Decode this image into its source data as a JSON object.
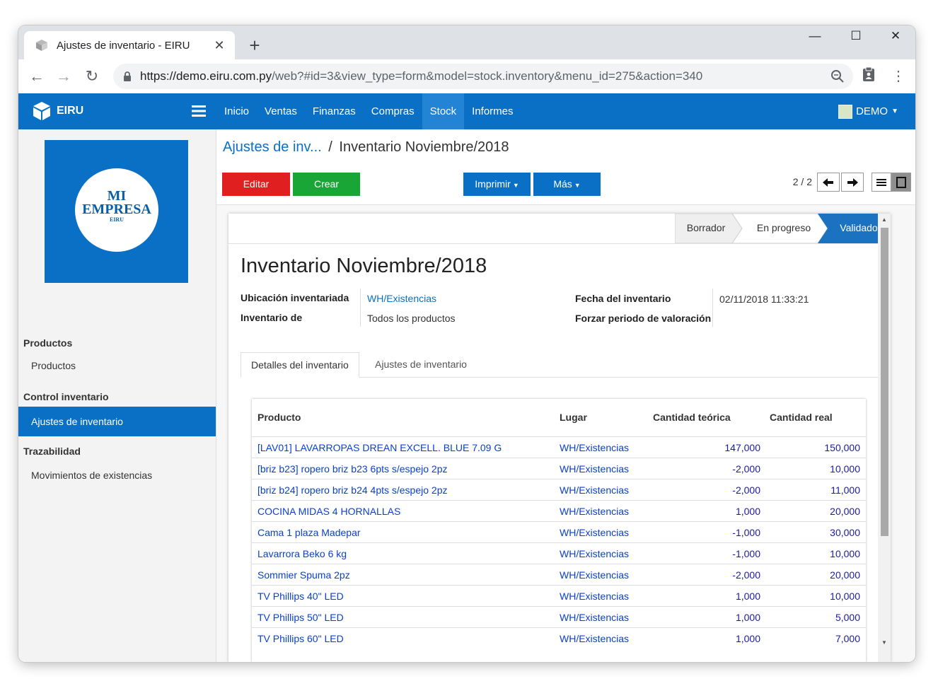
{
  "browser": {
    "tab_title": "Ajustes de inventario - EIRU",
    "new_tab": "+",
    "url_host": "https://demo.eiru.com.py",
    "url_path": "/web?#id=3&view_type=form&model=stock.inventory&menu_id=275&action=340"
  },
  "topbar": {
    "brand": "EIRU",
    "menu": [
      "Inicio",
      "Ventas",
      "Finanzas",
      "Compras",
      "Stock",
      "Informes"
    ],
    "active_menu": "Stock",
    "user": "DEMO"
  },
  "logo": {
    "line1": "MI",
    "line2": "EMPRESA",
    "line3": "EIRU"
  },
  "sidebar": {
    "sections": [
      {
        "title": "Productos",
        "items": [
          "Productos"
        ]
      },
      {
        "title": "Control inventario",
        "items": [
          "Ajustes de inventario"
        ]
      },
      {
        "title": "Trazabilidad",
        "items": [
          "Movimientos de existencias"
        ]
      }
    ]
  },
  "breadcrumb": {
    "parent": "Ajustes de inv...",
    "separator": "/",
    "current": "Inventario Noviembre/2018"
  },
  "actions": {
    "edit": "Editar",
    "create": "Crear",
    "print": "Imprimir",
    "more": "Más"
  },
  "pager": {
    "text": "2 / 2"
  },
  "status": {
    "stages": [
      "Borrador",
      "En progreso",
      "Validado"
    ],
    "active": "Validado"
  },
  "form": {
    "title": "Inventario Noviembre/2018",
    "location_label": "Ubicación inventariada",
    "location_value": "WH/Existencias",
    "inventory_of_label": "Inventario de",
    "inventory_of_value": "Todos los productos",
    "date_label": "Fecha del inventario",
    "date_value": "02/11/2018 11:33:21",
    "force_period_label": "Forzar periodo de valoración"
  },
  "tabs": [
    "Detalles del inventario",
    "Ajustes de inventario"
  ],
  "table": {
    "headers": [
      "Producto",
      "Lugar",
      "Cantidad teórica",
      "Cantidad real"
    ],
    "rows": [
      [
        "[LAV01] LAVARROPAS DREAN EXCELL. BLUE 7.09 G",
        "WH/Existencias",
        "147,000",
        "150,000"
      ],
      [
        "[briz b23] ropero briz b23 6pts s/espejo 2pz",
        "WH/Existencias",
        "-2,000",
        "10,000"
      ],
      [
        "[briz b24] ropero briz b24 4pts s/espejo 2pz",
        "WH/Existencias",
        "-2,000",
        "11,000"
      ],
      [
        "COCINA MIDAS 4 HORNALLAS",
        "WH/Existencias",
        "1,000",
        "20,000"
      ],
      [
        "Cama 1 plaza Madepar",
        "WH/Existencias",
        "-1,000",
        "30,000"
      ],
      [
        "Lavarrora Beko 6 kg",
        "WH/Existencias",
        "-1,000",
        "10,000"
      ],
      [
        "Sommier Spuma 2pz",
        "WH/Existencias",
        "-2,000",
        "20,000"
      ],
      [
        "TV Phillips 40\" LED",
        "WH/Existencias",
        "1,000",
        "10,000"
      ],
      [
        "TV Phillips 50\" LED",
        "WH/Existencias",
        "1,000",
        "5,000"
      ],
      [
        "TV Phillips 60\" LED",
        "WH/Existencias",
        "1,000",
        "7,000"
      ]
    ]
  },
  "colors": {
    "brand": "#0a70c6",
    "edit": "#e02020",
    "create": "#1aa537",
    "active_stage": "#1a72c0"
  }
}
